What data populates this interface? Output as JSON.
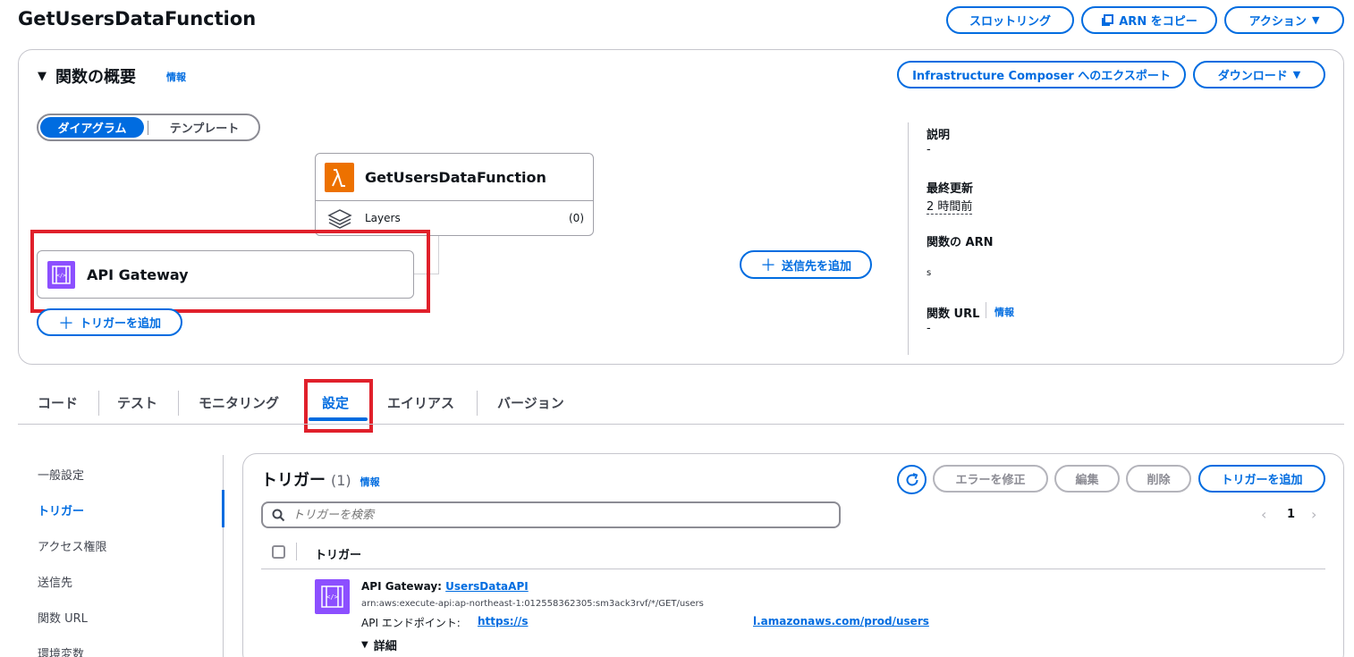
{
  "header": {
    "title": "GetUsersDataFunction",
    "throttle_label": "スロットリング",
    "copy_arn_label": "ARN をコピー",
    "actions_label": "アクション"
  },
  "overview": {
    "title": "関数の概要",
    "info_label": "情報",
    "export_label": "Infrastructure Composer へのエクスポート",
    "download_label": "ダウンロード",
    "view_toggle": {
      "diagram_label": "ダイアグラム",
      "template_label": "テンプレート"
    },
    "function_card": {
      "name": "GetUsersDataFunction",
      "layers_label": "Layers",
      "layers_count": "(0)"
    },
    "trigger_card": {
      "name": "API Gateway"
    },
    "add_destination_label": "送信先を追加",
    "add_trigger_label": "トリガーを追加",
    "details": {
      "description_label": "説明",
      "description_value": "-",
      "last_modified_label": "最終更新",
      "last_modified_value": "2 時間前",
      "arn_label": "関数の ARN",
      "arn_value": "s",
      "url_label": "関数 URL",
      "url_info_label": "情報",
      "url_value": "-"
    }
  },
  "tabs": [
    {
      "label": "コード"
    },
    {
      "label": "テスト"
    },
    {
      "label": "モニタリング"
    },
    {
      "label": "設定"
    },
    {
      "label": "エイリアス"
    },
    {
      "label": "バージョン"
    }
  ],
  "sidebar": {
    "items": [
      {
        "label": "一般設定"
      },
      {
        "label": "トリガー"
      },
      {
        "label": "アクセス権限"
      },
      {
        "label": "送信先"
      },
      {
        "label": "関数 URL"
      },
      {
        "label": "環境変数"
      }
    ]
  },
  "triggers": {
    "title": "トリガー",
    "count": "(1)",
    "info_label": "情報",
    "fix_errors_label": "エラーを修正",
    "edit_label": "編集",
    "delete_label": "削除",
    "add_trigger_label": "トリガーを追加",
    "search_placeholder": "トリガーを検索",
    "page_number": "1",
    "column_header": "トリガー",
    "rows": [
      {
        "type_label": "API Gateway: ",
        "api_name": "UsersDataAPI",
        "arn": "arn:aws:execute-api:ap-northeast-1:012558362305:sm3ack3rvf/*/GET/users",
        "endpoint_label": "API エンドポイント: ",
        "endpoint_start": "https://s",
        "endpoint_end": "l.amazonaws.com/prod/users",
        "details_label": "詳細"
      }
    ]
  },
  "colors": {
    "accent": "#006ce0",
    "highlight": "#e0202b",
    "lambda": "#ed7100",
    "apigw": "#8c4fff"
  }
}
